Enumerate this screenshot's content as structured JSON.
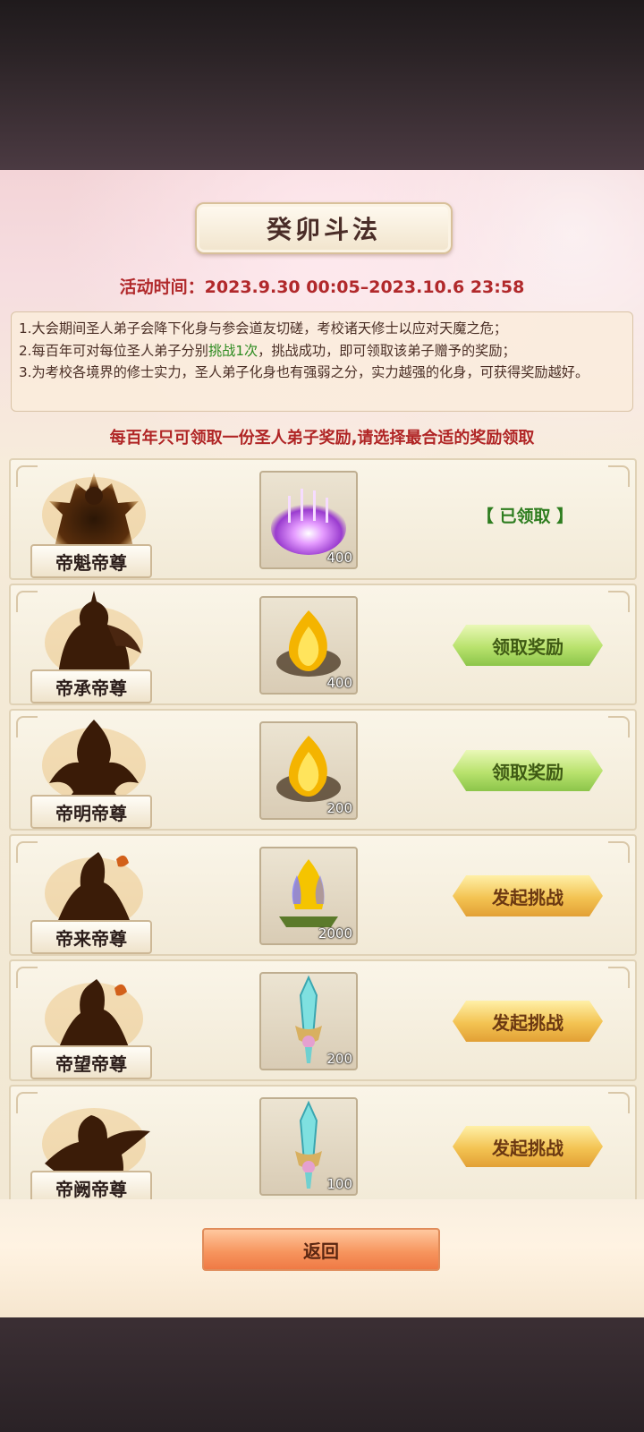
{
  "event": {
    "title": "癸卯斗法",
    "time_label": "活动时间：",
    "time_value": "2023.9.30 00:05–2023.10.6 23:58"
  },
  "rules": {
    "line1": "1.大会期间圣人弟子会降下化身与参会道友切磋，考校诸天修士以应对天魔之危；",
    "line2_prefix": "2.每百年可对每位圣人弟子分别",
    "line2_highlight": "挑战1次",
    "line2_suffix": "，挑战成功，即可领取该弟子赠予的奖励；",
    "line3": "3.为考校各境界的修士实力，圣人弟子化身也有强弱之分，实力越强的化身，可获得奖励越好。"
  },
  "notice": "每百年只可领取一份圣人弟子奖励,请选择最合适的奖励领取",
  "colors": {
    "accent_red": "#b1292b",
    "highlight_green": "#2b8a1e",
    "claim_green": "#b8e26d",
    "challenge_gold": "#f3c352"
  },
  "rows": [
    {
      "name": "帝魁帝尊",
      "item_icon": "purple-orb-icon",
      "qty": "400",
      "status": "【 已领取 】",
      "action": ""
    },
    {
      "name": "帝承帝尊",
      "item_icon": "gold-flame-icon",
      "qty": "400",
      "status": "",
      "action": "领取奖励",
      "action_style": "green"
    },
    {
      "name": "帝明帝尊",
      "item_icon": "gold-flame-icon",
      "qty": "200",
      "status": "",
      "action": "领取奖励",
      "action_style": "green"
    },
    {
      "name": "帝来帝尊",
      "item_icon": "flame-altar-icon",
      "qty": "2000",
      "status": "",
      "action": "发起挑战",
      "action_style": "gold"
    },
    {
      "name": "帝望帝尊",
      "item_icon": "crystal-sword-icon",
      "qty": "200",
      "status": "",
      "action": "发起挑战",
      "action_style": "gold"
    },
    {
      "name": "帝阙帝尊",
      "item_icon": "crystal-sword-icon",
      "qty": "100",
      "status": "",
      "action": "发起挑战",
      "action_style": "gold"
    }
  ],
  "footer": {
    "back_label": "返回"
  }
}
